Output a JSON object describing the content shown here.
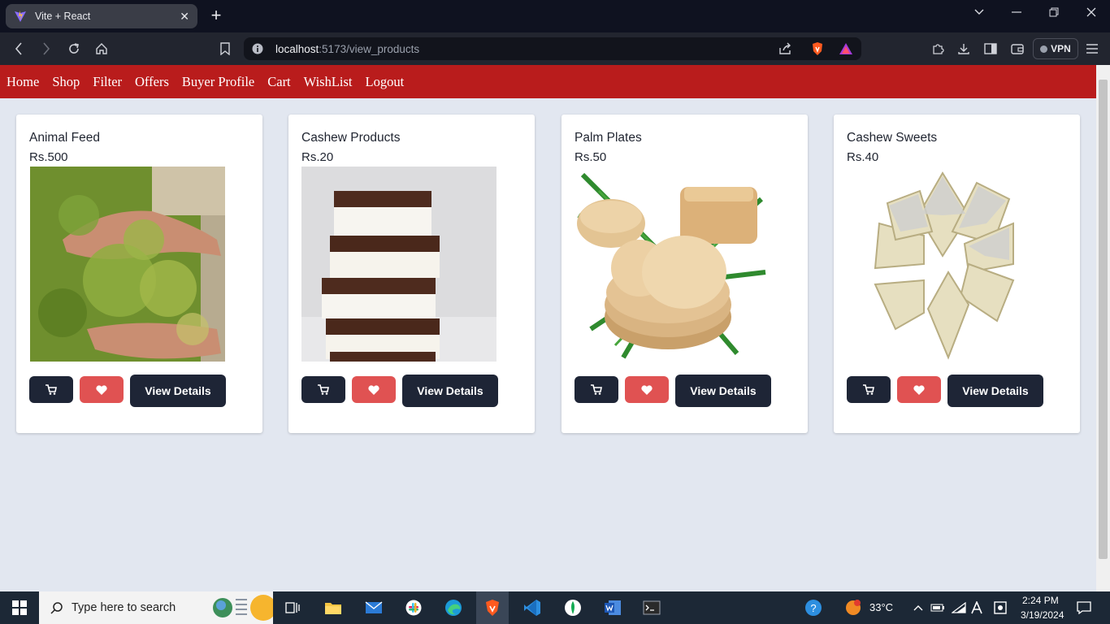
{
  "browser": {
    "tab_title": "Vite + React",
    "url_host": "localhost",
    "url_path": ":5173/view_products",
    "vpn_label": "VPN"
  },
  "navbar": {
    "items": [
      "Home",
      "Shop",
      "Filter",
      "Offers",
      "Buyer Profile",
      "Cart",
      "WishList",
      "Logout"
    ]
  },
  "products": [
    {
      "name": "Animal Feed",
      "price": "Rs.500",
      "image": "animal-feed-photo"
    },
    {
      "name": "Cashew Products",
      "price": "Rs.20",
      "image": "cashew-chocolate-bars-photo"
    },
    {
      "name": "Palm Plates",
      "price": "Rs.50",
      "image": "palm-leaf-plates-photo"
    },
    {
      "name": "Cashew Sweets",
      "price": "Rs.40",
      "image": "kaju-katli-photo"
    }
  ],
  "product_actions": {
    "view_label": "View Details",
    "cart_icon": "cart-icon",
    "wish_icon": "heart-icon"
  },
  "taskbar": {
    "search_placeholder": "Type here to search",
    "temperature": "33°C",
    "time": "2:24 PM",
    "date": "3/19/2024"
  },
  "colors": {
    "navbar": "#b91c1c",
    "button_dark": "#1e2536",
    "button_wish": "#e05252",
    "page_bg": "#e2e7f0"
  }
}
